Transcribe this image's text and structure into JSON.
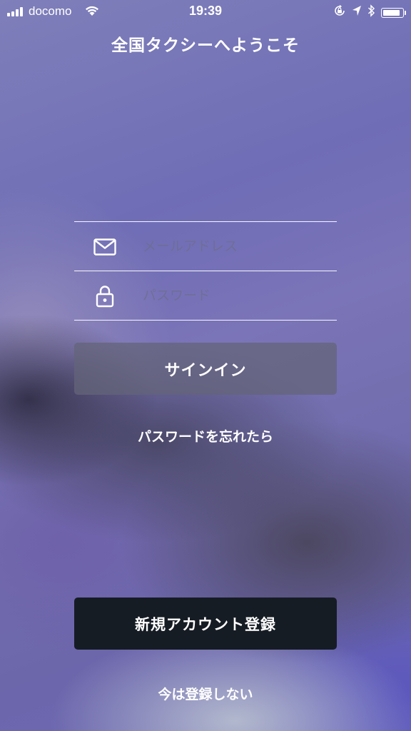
{
  "status_bar": {
    "carrier": "docomo",
    "time": "19:39",
    "icons": [
      "signal-bars-icon",
      "wifi-icon",
      "orientation-lock-icon",
      "location-arrow-icon",
      "bluetooth-icon",
      "battery-icon"
    ],
    "battery_level": 0.9
  },
  "header": {
    "title": "全国タクシーへようこそ"
  },
  "form": {
    "email_placeholder": "メールアドレス",
    "email_value": "",
    "email_icon": "envelope-icon",
    "password_placeholder": "パスワード",
    "password_value": "",
    "password_icon": "lock-icon"
  },
  "actions": {
    "signin_label": "サインイン",
    "forgot_label": "パスワードを忘れたら",
    "register_label": "新規アカウント登録",
    "skip_label": "今は登録しない"
  },
  "colors": {
    "background_accent": "#6f6db6",
    "signin_button_bg": "#64647a",
    "register_button_bg": "#161c24",
    "text": "#ffffff"
  }
}
